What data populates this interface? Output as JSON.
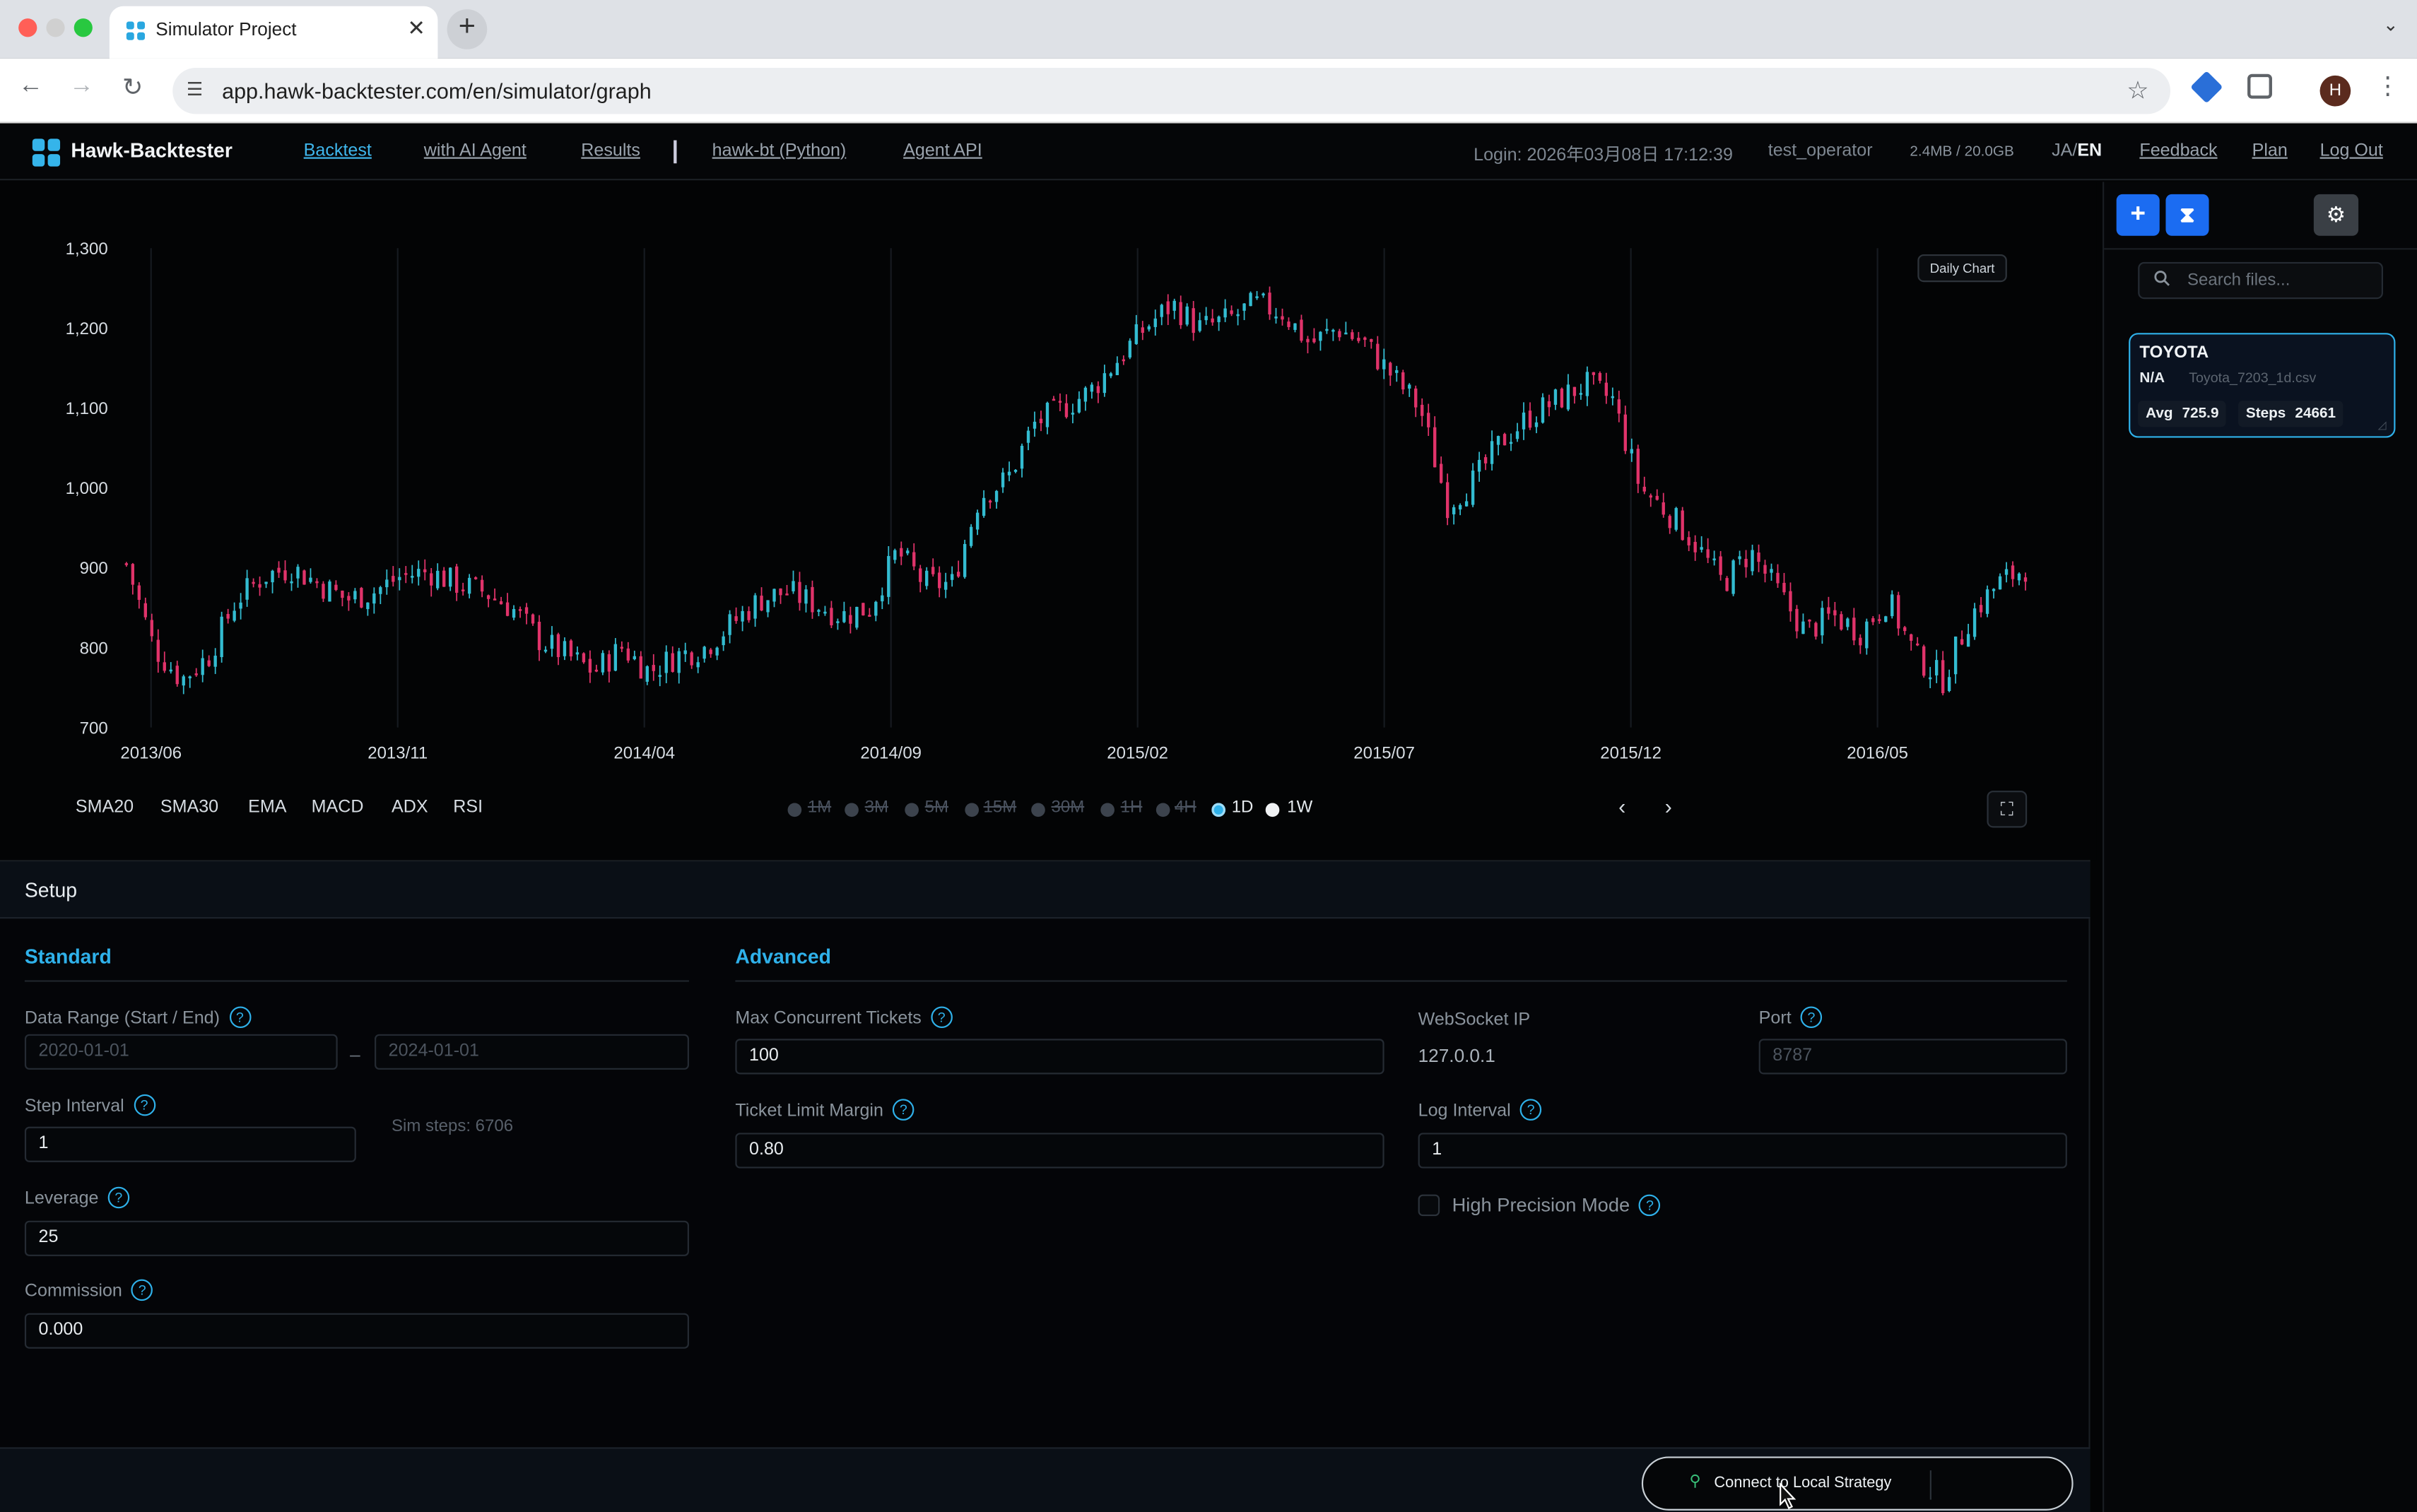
{
  "browser": {
    "tab_title": "Simulator Project",
    "tab_close": "✕",
    "new_tab": "+",
    "tab_menu": "⌄",
    "url": "app.hawk-backtester.com/en/simulator/graph",
    "profile_initial": "H"
  },
  "nav": {
    "brand": "Hawk-Backtester",
    "links": [
      {
        "label": "Backtest",
        "active": true
      },
      {
        "label": "with AI Agent"
      },
      {
        "label": "Results"
      },
      {
        "label": "hawk-bt (Python)"
      },
      {
        "label": "Agent API"
      }
    ],
    "login": "Login: 2026年03月08日 17:12:39",
    "user": "test_operator",
    "storage": "2.4MB / 20.0GB",
    "lang_ja": "JA",
    "lang_sep": "/",
    "lang_en": "EN",
    "feedback": "Feedback",
    "plan": "Plan",
    "logout": "Log Out"
  },
  "chart_data": {
    "type": "candlestick",
    "title": "",
    "badge": "Daily Chart",
    "ylim": [
      700,
      1300
    ],
    "yticks": [
      "1,300",
      "1,200",
      "1,100",
      "1,000",
      "900",
      "800",
      "700"
    ],
    "ytick_values": [
      1300,
      1200,
      1100,
      1000,
      900,
      800,
      700
    ],
    "xticks": [
      "2013/06",
      "2013/11",
      "2014/04",
      "2014/09",
      "2015/02",
      "2015/07",
      "2015/12",
      "2016/05"
    ],
    "grid": true,
    "colors": {
      "up": "#33bcd1",
      "down": "#e0336a",
      "grid": "#161a20",
      "axis_text": "#d8dee4"
    },
    "series": [
      {
        "name": "",
        "values": [
          905,
          800,
          760,
          790,
          860,
          890,
          900,
          880,
          860,
          870,
          890,
          895,
          880,
          870,
          850,
          810,
          790,
          770,
          800,
          770,
          790,
          800,
          830,
          860,
          870,
          855,
          840,
          850,
          920,
          880,
          880,
          990,
          1010,
          1080,
          1100,
          1120,
          1160,
          1200,
          1230,
          1200,
          1210,
          1230,
          1220,
          1180,
          1200,
          1180,
          1140,
          1100,
          980,
          1010,
          1060,
          1090,
          1110,
          1130,
          1110,
          1000,
          970,
          930,
          880,
          920,
          870,
          820,
          840,
          820,
          860,
          790,
          760,
          840,
          880,
          900
        ]
      }
    ]
  },
  "chart_controls": {
    "indicators": [
      "SMA20",
      "SMA30",
      "EMA",
      "MACD",
      "ADX",
      "RSI"
    ],
    "timeframes": [
      {
        "label": "1M",
        "state": "disabled"
      },
      {
        "label": "3M",
        "state": "disabled"
      },
      {
        "label": "5M",
        "state": "disabled"
      },
      {
        "label": "15M",
        "state": "disabled"
      },
      {
        "label": "30M",
        "state": "disabled"
      },
      {
        "label": "1H",
        "state": "disabled"
      },
      {
        "label": "4H",
        "state": "disabled"
      },
      {
        "label": "1D",
        "state": "selected"
      },
      {
        "label": "1W",
        "state": "available"
      }
    ],
    "prev": "‹",
    "next": "›",
    "fullscreen_icon": "⛶"
  },
  "setup": {
    "title": "Setup",
    "standard_title": "Standard",
    "advanced_title": "Advanced",
    "help_glyph": "?",
    "data_range_label": "Data Range (Start / End)",
    "start_date_placeholder": "2020-01-01",
    "end_date_placeholder": "2024-01-01",
    "range_dash": "–",
    "step_interval_label": "Step Interval",
    "step_interval_value": "1",
    "sim_steps": "Sim steps: 6706",
    "leverage_label": "Leverage",
    "leverage_value": "25",
    "commission_label": "Commission",
    "commission_value": "0.000",
    "max_tickets_label": "Max Concurrent Tickets",
    "max_tickets_value": "100",
    "ticket_margin_label": "Ticket Limit Margin",
    "ticket_margin_value": "0.80",
    "ws_ip_label": "WebSocket IP",
    "ws_ip_value": "127.0.0.1",
    "port_label": "Port",
    "port_placeholder": "8787",
    "log_interval_label": "Log Interval",
    "log_interval_value": "1",
    "high_precision_label": "High Precision Mode",
    "high_precision_checked": false,
    "connect_label": "Connect to Local Strategy"
  },
  "sidebar": {
    "add_icon": "+",
    "run_icon": "⧗",
    "gear_icon": "⚙",
    "search_placeholder": "Search files...",
    "file": {
      "name": "TOYOTA",
      "status": "N/A",
      "filename": "Toyota_7203_1d.csv",
      "avg_label": "Avg",
      "avg_value": "725.9",
      "steps_label": "Steps",
      "steps_value": "24661"
    }
  }
}
